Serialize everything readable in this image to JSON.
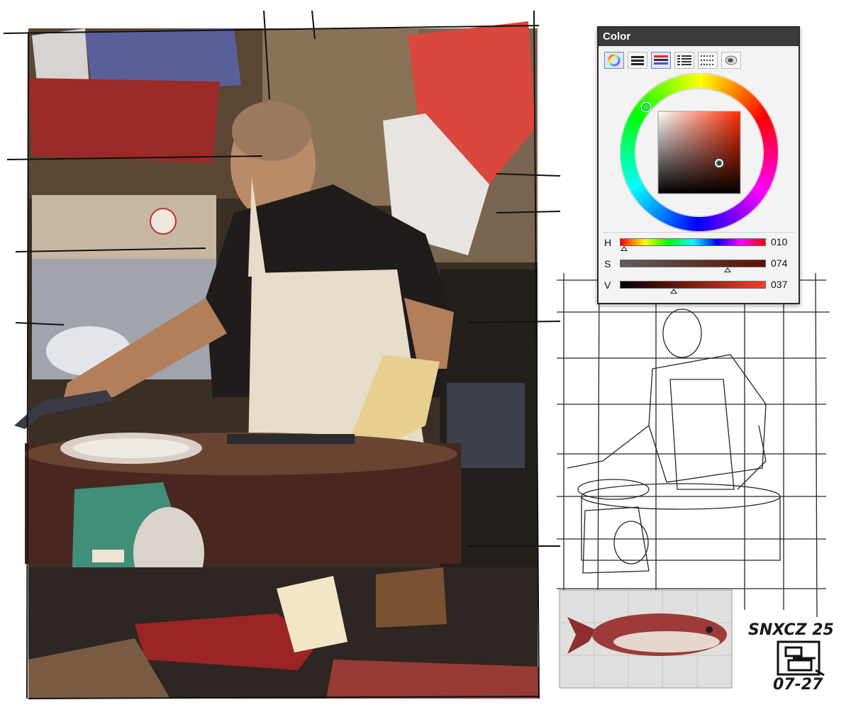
{
  "color_panel": {
    "title": "Color",
    "modes": [
      {
        "name": "wheel",
        "icon": "color-wheel-icon",
        "active": true
      },
      {
        "name": "rgb-bars",
        "icon": "rgb-bars-icon",
        "active": false
      },
      {
        "name": "hsv-bars",
        "icon": "hsv-bars-icon",
        "active": true
      },
      {
        "name": "palette-list",
        "icon": "palette-list-icon",
        "active": false
      },
      {
        "name": "swatch-grid",
        "icon": "swatch-grid-icon",
        "active": false
      },
      {
        "name": "mixer",
        "icon": "mixer-icon",
        "active": false
      }
    ],
    "selected_color": "#5e1810",
    "sliders": [
      {
        "label": "H",
        "value": "010",
        "fraction": 0.03
      },
      {
        "label": "S",
        "value": "074",
        "fraction": 0.74
      },
      {
        "label": "V",
        "value": "037",
        "fraction": 0.37
      }
    ]
  },
  "signature": {
    "text": "SNXCZ 25",
    "date": "07-27"
  }
}
